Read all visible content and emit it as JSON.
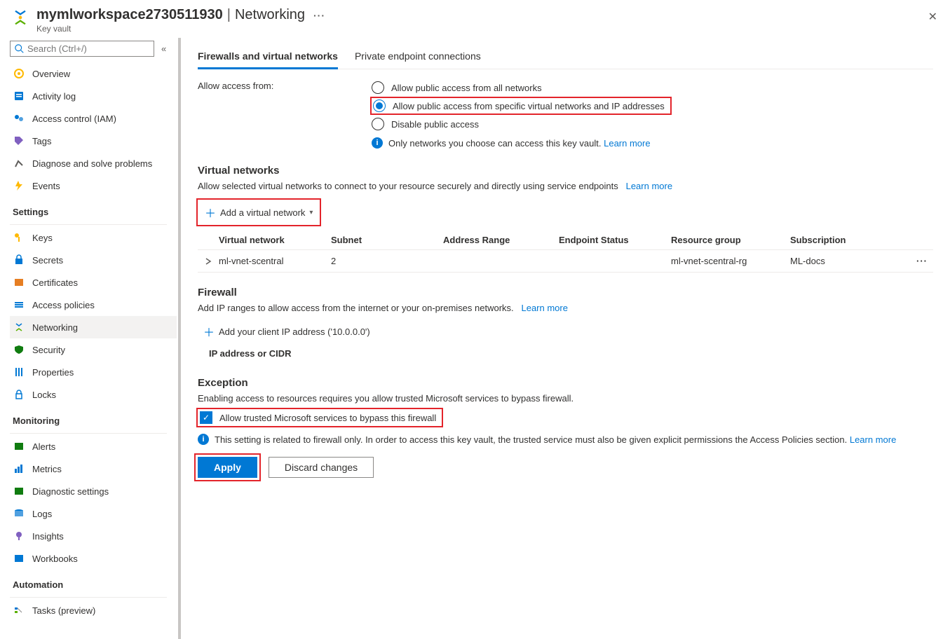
{
  "header": {
    "title": "mymlworkspace2730511930",
    "section": "Networking",
    "subtitle": "Key vault"
  },
  "search": {
    "placeholder": "Search (Ctrl+/)"
  },
  "nav": {
    "top": [
      {
        "label": "Overview"
      },
      {
        "label": "Activity log"
      },
      {
        "label": "Access control (IAM)"
      },
      {
        "label": "Tags"
      },
      {
        "label": "Diagnose and solve problems"
      },
      {
        "label": "Events"
      }
    ],
    "groups": [
      {
        "title": "Settings",
        "items": [
          {
            "label": "Keys"
          },
          {
            "label": "Secrets"
          },
          {
            "label": "Certificates"
          },
          {
            "label": "Access policies"
          },
          {
            "label": "Networking",
            "active": true
          },
          {
            "label": "Security"
          },
          {
            "label": "Properties"
          },
          {
            "label": "Locks"
          }
        ]
      },
      {
        "title": "Monitoring",
        "items": [
          {
            "label": "Alerts"
          },
          {
            "label": "Metrics"
          },
          {
            "label": "Diagnostic settings"
          },
          {
            "label": "Logs"
          },
          {
            "label": "Insights"
          },
          {
            "label": "Workbooks"
          }
        ]
      },
      {
        "title": "Automation",
        "items": [
          {
            "label": "Tasks (preview)"
          }
        ]
      }
    ]
  },
  "tabs": {
    "firewalls": "Firewalls and virtual networks",
    "private": "Private endpoint connections"
  },
  "access": {
    "label": "Allow access from:",
    "opt1": "Allow public access from all networks",
    "opt2": "Allow public access from specific virtual networks and IP addresses",
    "opt3": "Disable public access",
    "info": "Only networks you choose can access this key vault.",
    "learn": "Learn more"
  },
  "vnet": {
    "title": "Virtual networks",
    "desc": "Allow selected virtual networks to connect to your resource securely and directly using service endpoints",
    "learn": "Learn more",
    "addBtn": "Add a virtual network",
    "headers": {
      "vn": "Virtual network",
      "subnet": "Subnet",
      "range": "Address Range",
      "status": "Endpoint Status",
      "rg": "Resource group",
      "sub": "Subscription"
    },
    "row": {
      "vn": "ml-vnet-scentral",
      "subnet": "2",
      "range": "",
      "status": "",
      "rg": "ml-vnet-scentral-rg",
      "sub": "ML-docs"
    }
  },
  "firewall": {
    "title": "Firewall",
    "desc": "Add IP ranges to allow access from the internet or your on-premises networks.",
    "learn": "Learn more",
    "addClient": "Add your client IP address ('10.0.0.0')",
    "ipLabel": "IP address or CIDR"
  },
  "exception": {
    "title": "Exception",
    "desc": "Enabling access to resources requires you allow trusted Microsoft services to bypass firewall.",
    "chk": "Allow trusted Microsoft services to bypass this firewall",
    "info": "This setting is related to firewall only. In order to access this key vault, the trusted service must also be given explicit permissions the Access Policies section.",
    "learn": "Learn more"
  },
  "footer": {
    "apply": "Apply",
    "discard": "Discard changes"
  }
}
